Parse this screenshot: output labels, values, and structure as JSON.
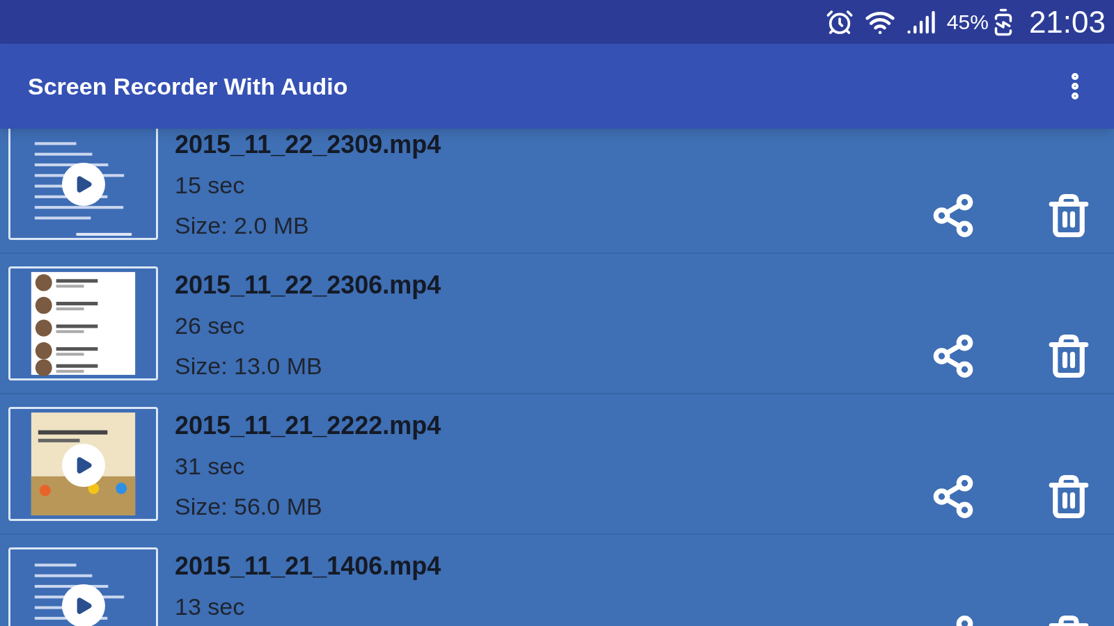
{
  "status_bar": {
    "battery": "45%",
    "time": "21:03"
  },
  "app_bar": {
    "title": "Screen Recorder With Audio"
  },
  "recordings": [
    {
      "file": "2015_11_22_2309.mp4",
      "duration": "15 sec",
      "size": "Size: 2.0 MB",
      "play_overlay": true
    },
    {
      "file": "2015_11_22_2306.mp4",
      "duration": "26 sec",
      "size": "Size: 13.0 MB",
      "play_overlay": false
    },
    {
      "file": "2015_11_21_2222.mp4",
      "duration": "31 sec",
      "size": "Size: 56.0 MB",
      "play_overlay": true
    },
    {
      "file": "2015_11_21_1406.mp4",
      "duration": "13 sec",
      "play_overlay": true
    }
  ]
}
